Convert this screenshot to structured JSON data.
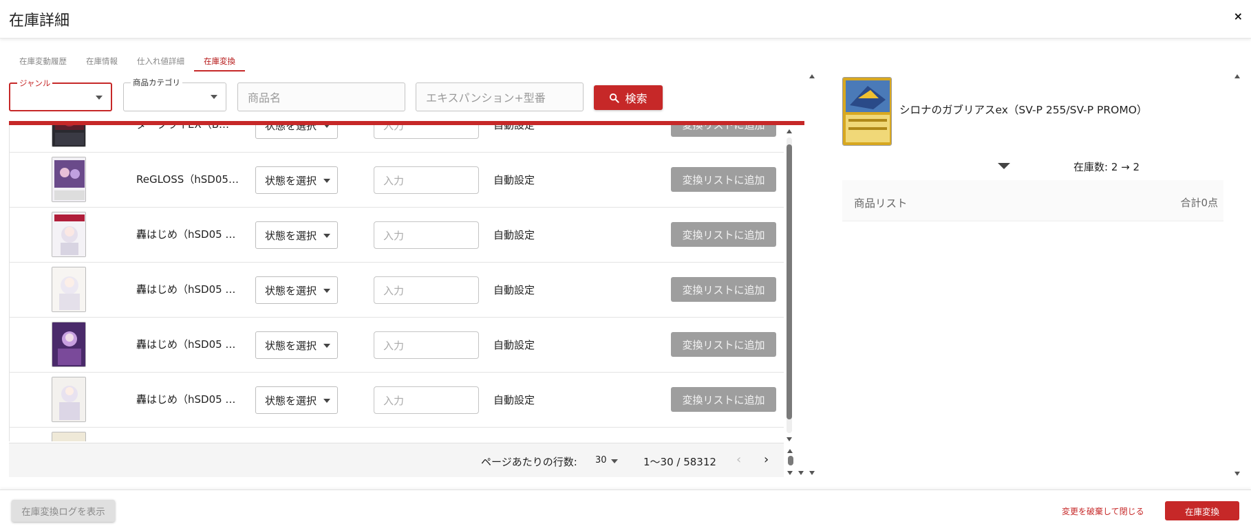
{
  "header": {
    "title": "在庫詳細",
    "close_label": "×"
  },
  "tabs": [
    {
      "label": "在庫変動履歴",
      "active": false
    },
    {
      "label": "在庫情報",
      "active": false
    },
    {
      "label": "仕入れ値詳細",
      "active": false
    },
    {
      "label": "在庫変換",
      "active": true
    }
  ],
  "filters": {
    "genre_label": "ジャンル",
    "category_label": "商品カテゴリ",
    "name_placeholder": "商品名",
    "expansion_placeholder": "エキスパンション+型番",
    "search_label": "検索"
  },
  "rows": [
    {
      "name": "ダークライEX（B…",
      "state": "状態を選択",
      "qty_placeholder": "入力",
      "auto": "自動設定",
      "add": "変換リストに追加"
    },
    {
      "name": "ReGLOSS（hSD05 …",
      "state": "状態を選択",
      "qty_placeholder": "入力",
      "auto": "自動設定",
      "add": "変換リストに追加"
    },
    {
      "name": "轟はじめ（hSD05 …",
      "state": "状態を選択",
      "qty_placeholder": "入力",
      "auto": "自動設定",
      "add": "変換リストに追加"
    },
    {
      "name": "轟はじめ（hSD05 …",
      "state": "状態を選択",
      "qty_placeholder": "入力",
      "auto": "自動設定",
      "add": "変換リストに追加"
    },
    {
      "name": "轟はじめ（hSD05 …",
      "state": "状態を選択",
      "qty_placeholder": "入力",
      "auto": "自動設定",
      "add": "変換リストに追加"
    },
    {
      "name": "轟はじめ（hSD05 …",
      "state": "状態を選択",
      "qty_placeholder": "入力",
      "auto": "自動設定",
      "add": "変換リストに追加"
    }
  ],
  "pagination": {
    "rows_per_page_label": "ページあたりの行数:",
    "rows_per_page": "30",
    "range": "1〜30 / 58312"
  },
  "right": {
    "card_name": "シロナのガブリアスex（SV-P 255/SV-P PROMO）",
    "stock": "在庫数: 2 → 2",
    "product_list_title": "商品リスト",
    "product_list_total": "合計0点"
  },
  "footer": {
    "log_button": "在庫変換ログを表示",
    "discard_label": "変更を破棄して閉じる",
    "convert_label": "在庫変換"
  },
  "colors": {
    "accent": "#c62828",
    "disabled": "#9e9e9e"
  }
}
